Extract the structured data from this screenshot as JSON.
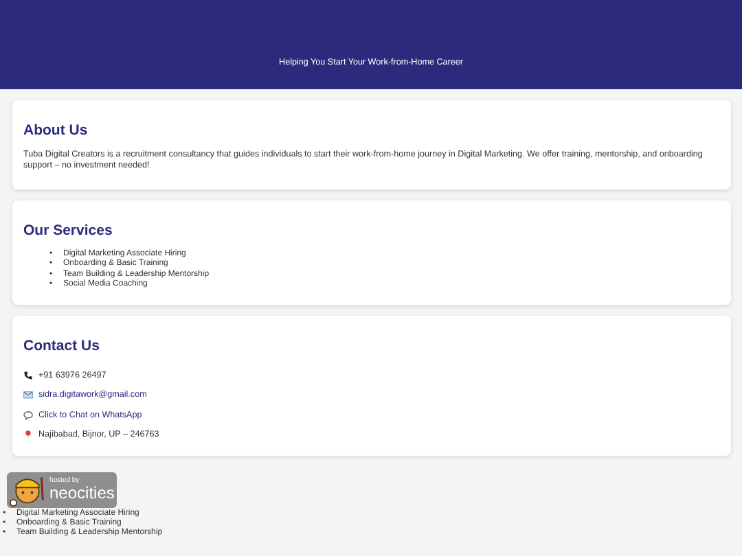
{
  "header": {
    "tagline": "Helping You Start Your Work-from-Home Career"
  },
  "about": {
    "title": "About Us",
    "text": "Tuba Digital Creators is a recruitment consultancy that guides individuals to start their work-from-home journey in Digital Marketing. We offer training, mentorship, and onboarding support – no investment needed!"
  },
  "services": {
    "title": "Our Services",
    "bullet": "•",
    "items": [
      "Digital Marketing Associate Hiring",
      "Onboarding & Basic Training",
      "Team Building & Leadership Mentorship",
      "Social Media Coaching"
    ]
  },
  "contact": {
    "title": "Contact Us",
    "items": [
      {
        "kind": "phone",
        "text": "+91 63976 26497"
      },
      {
        "kind": "email",
        "text": "sidra.digitawork@gmail.com"
      },
      {
        "kind": "chat",
        "text": "Click to Chat on WhatsApp"
      },
      {
        "kind": "location",
        "text": "Najibabad, Bijnor, UP – 246763"
      }
    ]
  },
  "badge": {
    "small": "hosted by",
    "large": "neocities"
  },
  "footer_bullet": "•",
  "footer_list": [
    "Digital Marketing Associate Hiring",
    "Onboarding & Basic Training",
    "Team Building & Leadership Mentorship"
  ]
}
